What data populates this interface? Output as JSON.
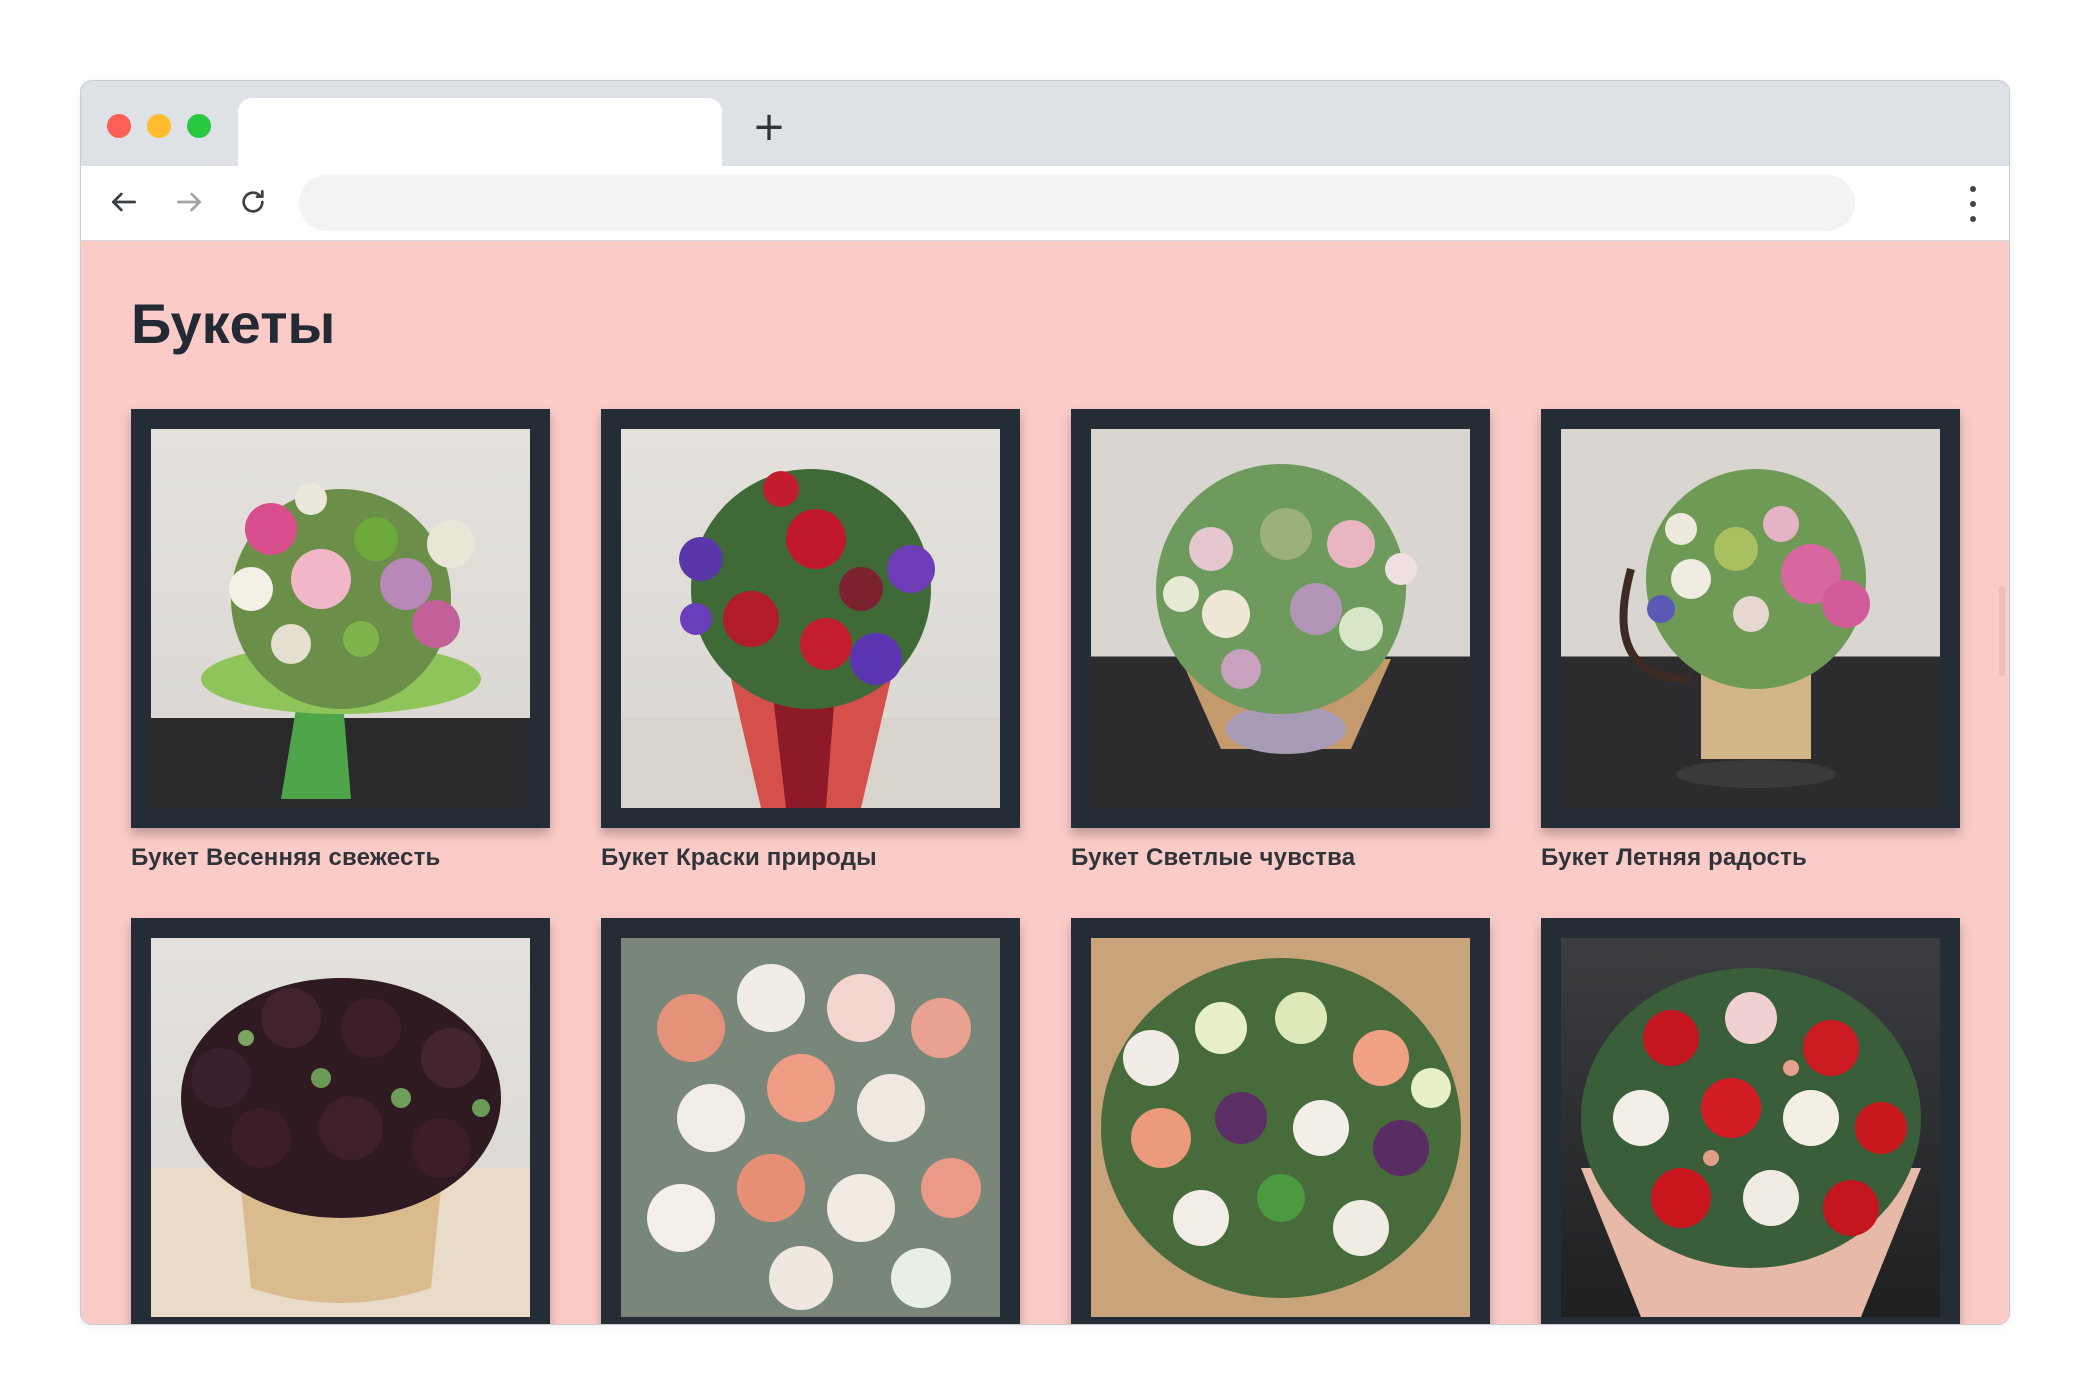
{
  "browser": {
    "tab_title": "",
    "new_tab_symbol": "+",
    "address_value": "",
    "colors": {
      "tabbar": "#dee1e6",
      "close": "#fe5f57",
      "minimize": "#febc2e",
      "maximize": "#28c840"
    },
    "icons": [
      "back-arrow-icon",
      "forward-arrow-icon",
      "reload-icon",
      "kebab-menu-icon"
    ]
  },
  "page": {
    "background": "#fbcbc8",
    "title": "Букеты",
    "products": [
      {
        "name": "Букет Весенняя свежесть"
      },
      {
        "name": "Букет Краски природы"
      },
      {
        "name": "Букет Светлые чувства"
      },
      {
        "name": "Букет Летняя радость"
      },
      {
        "name": ""
      },
      {
        "name": ""
      },
      {
        "name": ""
      },
      {
        "name": ""
      }
    ]
  }
}
